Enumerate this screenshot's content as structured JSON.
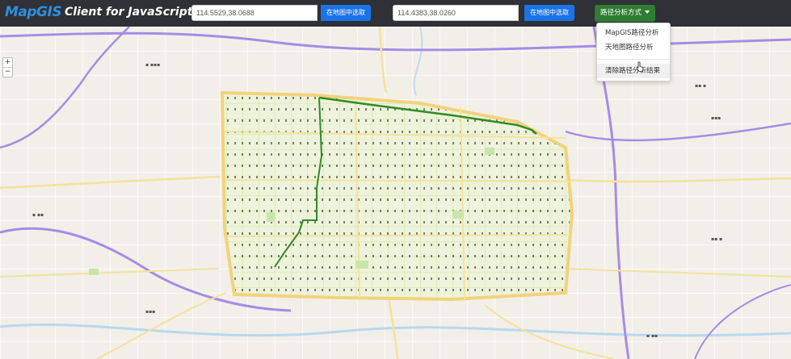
{
  "header": {
    "logo_text": "MapGIS",
    "subtitle": "Client for JavaScript",
    "start_coord": {
      "value": "114.5529,38.0688"
    },
    "start_pick_button": "在地图中选取",
    "end_coord": {
      "value": "114.4383,38.0260"
    },
    "end_pick_button": "在地图中选取",
    "analysis_button": "路径分析方式"
  },
  "dropdown": {
    "items": [
      "MapGIS路径分析",
      "天地图路径分析"
    ],
    "clear_item": "清除路径分析结果"
  },
  "map": {
    "zoom_in": "+",
    "zoom_out": "−",
    "colors": {
      "background": "#f2efe9",
      "ring_road": "#f3d27a",
      "arterial": "#f5e29a",
      "local_road": "#d4e8a8",
      "highway": "#a68be6",
      "route": "#2e8b22",
      "river": "#a9d3f0"
    }
  },
  "colors": {
    "header_bg": "#2f3136",
    "logo": "#2f8fe0",
    "pick_button": "#1a73e8",
    "analysis_button": "#2e7d32"
  }
}
